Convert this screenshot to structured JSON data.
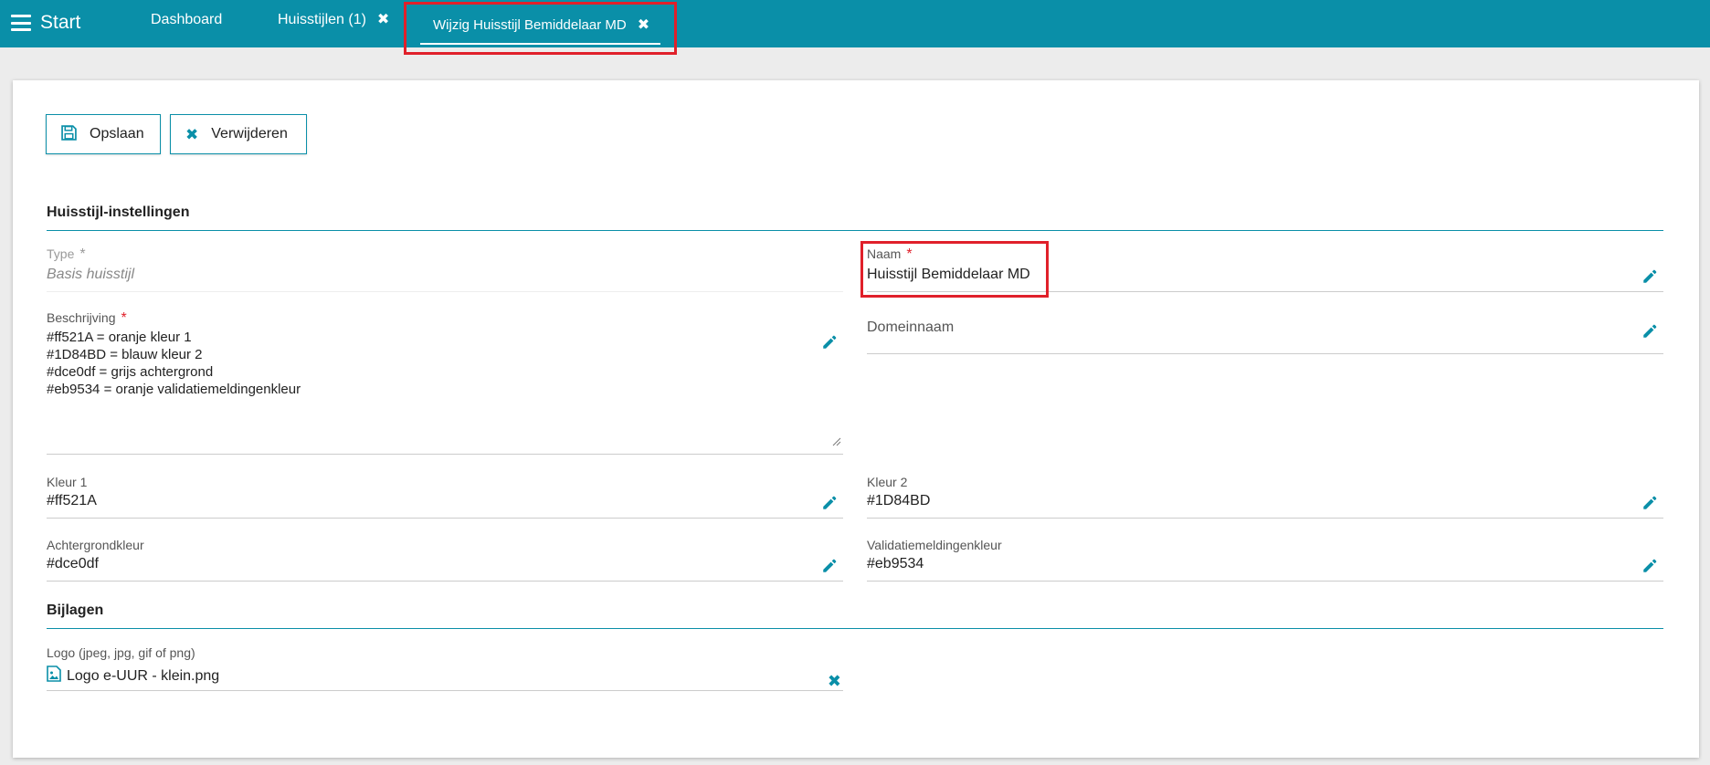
{
  "topbar": {
    "menu_label": "Start",
    "tabs": [
      {
        "label": "Dashboard"
      },
      {
        "label": "Huisstijlen (1)"
      },
      {
        "label": "Wijzig Huisstijl Bemiddelaar MD"
      }
    ]
  },
  "toolbar": {
    "save_label": "Opslaan",
    "delete_label": "Verwijderen"
  },
  "settings": {
    "section_title": "Huisstijl-instellingen",
    "type_label": "Type",
    "type_value": "Basis huisstijl",
    "naam_label": "Naam",
    "naam_value": "Huisstijl Bemiddelaar MD",
    "beschrijving_label": "Beschrijving",
    "beschrijving_value": "#ff521A = oranje kleur 1\n#1D84BD = blauw kleur 2\n#dce0df = grijs achtergrond\n#eb9534 = oranje validatiemeldingenkleur",
    "domeinnaam_label": "Domeinnaam",
    "domeinnaam_value": "",
    "kleur1_label": "Kleur 1",
    "kleur1_value": "#ff521A",
    "kleur2_label": "Kleur 2",
    "kleur2_value": "#1D84BD",
    "achtergrond_label": "Achtergrondkleur",
    "achtergrond_value": "#dce0df",
    "validatie_label": "Validatiemeldingenkleur",
    "validatie_value": "#eb9534",
    "required_marker": "*"
  },
  "attachments": {
    "section_title": "Bijlagen",
    "logo_label": "Logo (jpeg, jpg, gif of png)",
    "logo_file": "Logo e-UUR - klein.png"
  },
  "colors": {
    "accent": "#0a8fa8",
    "highlight": "#e0202a",
    "required": "#e0202a"
  }
}
